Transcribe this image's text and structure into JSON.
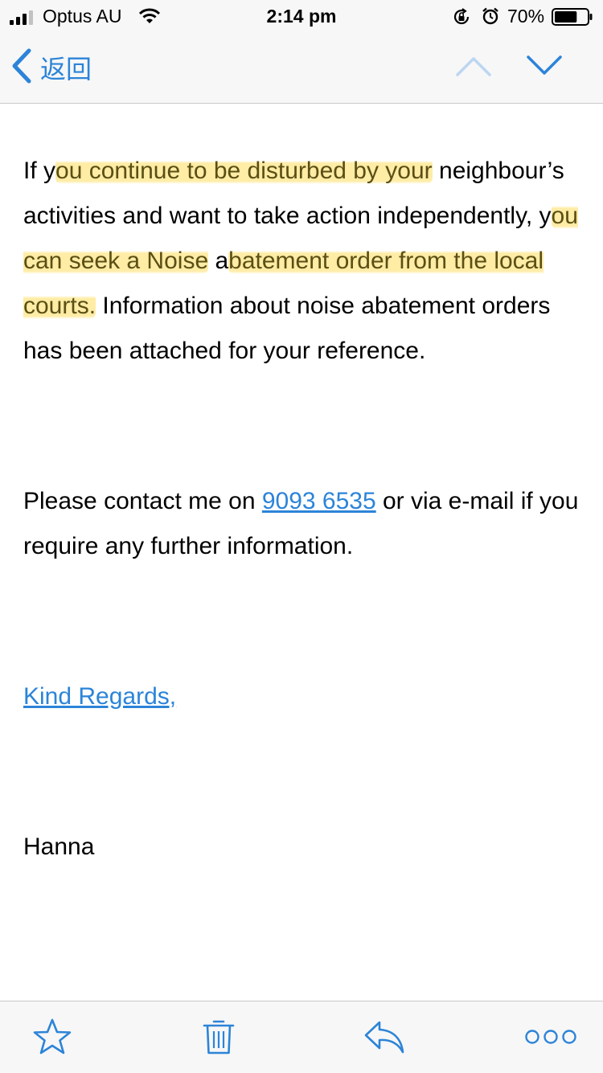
{
  "status_bar": {
    "carrier": "Optus AU",
    "time": "2:14 pm",
    "battery_percent": "70%",
    "battery_level": 0.7,
    "signal_bars_filled": 3,
    "signal_bars_total": 4
  },
  "nav": {
    "back_label": "返回",
    "icons": [
      "chevron-left-icon",
      "chevron-up-icon",
      "chevron-down-icon"
    ]
  },
  "email": {
    "paragraph1": [
      {
        "text": "If y",
        "highlight": false
      },
      {
        "text": "ou continue to be disturbed by your",
        "highlight": true
      },
      {
        "text": " neighbour’s activities and want to take action independently, y",
        "highlight": false
      },
      {
        "text": "ou can seek a Noise",
        "highlight": true
      },
      {
        "text": " a",
        "highlight": false
      },
      {
        "text": "batement order from the local courts.",
        "highlight": true
      },
      {
        "text": " Information about noise abatement orders has been attached for your reference.",
        "highlight": false
      }
    ],
    "paragraph2_before": "Please contact me on ",
    "phone": "9093 6535",
    "paragraph2_after": " or via e-mail if you require any further information.",
    "closing": "Kind Regards,",
    "signature": "Hanna"
  },
  "toolbar": {
    "icons": [
      "flag-star-icon",
      "trash-icon",
      "reply-icon",
      "more-icon"
    ]
  },
  "colors": {
    "accent": "#2c84d8",
    "highlight": "#ffe06e",
    "bar_background": "#f7f7f7"
  }
}
